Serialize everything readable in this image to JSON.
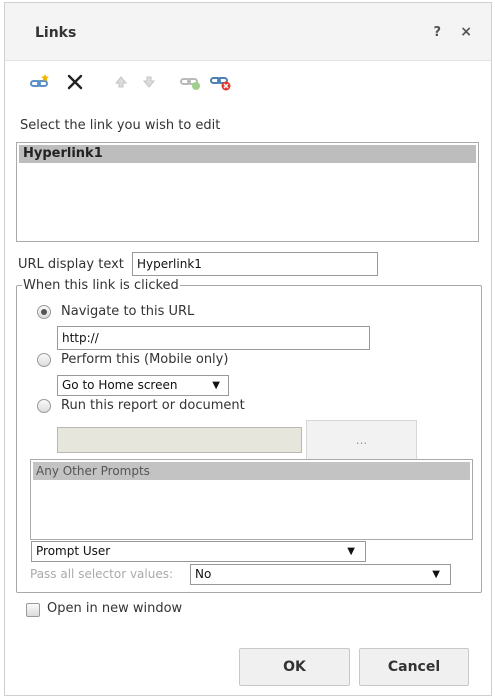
{
  "dialog": {
    "title": "Links",
    "help_label": "?",
    "close_label": "×"
  },
  "toolbar": {
    "icons": [
      "add-link-icon",
      "delete-icon",
      "move-up-icon",
      "move-down-icon",
      "link-icon",
      "remove-link-icon"
    ]
  },
  "link_list": {
    "label": "Select the link you wish to edit",
    "items": [
      "Hyperlink1"
    ]
  },
  "url_display": {
    "label": "URL display text",
    "value": "Hyperlink1"
  },
  "click_group": {
    "legend": "When this link is clicked",
    "options": {
      "navigate": "Navigate to this URL",
      "perform": "Perform this (Mobile only)",
      "run_report": "Run this report or document"
    },
    "url_value": "http://",
    "perform_select": "Go to Home screen",
    "browse_label": "...",
    "prompts_header": "Any Other Prompts",
    "prompt_select": "Prompt User",
    "pass_selector_label": "Pass all selector values:",
    "pass_selector_value": "No",
    "arrow": "▼"
  },
  "open_new_window_label": "Open in new window",
  "buttons": {
    "ok": "OK",
    "cancel": "Cancel"
  }
}
